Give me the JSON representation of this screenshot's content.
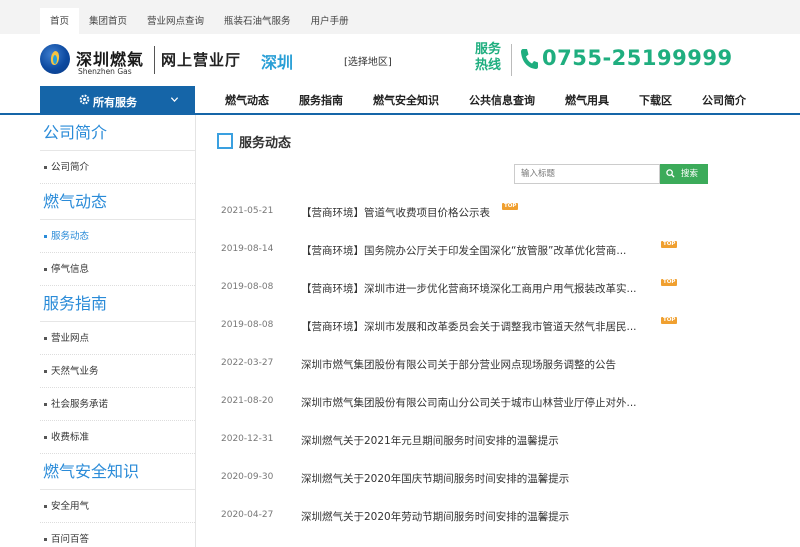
{
  "topnav": {
    "items": [
      {
        "label": "首页",
        "active": true
      },
      {
        "label": "集团首页",
        "active": false
      },
      {
        "label": "营业网点查询",
        "active": false
      },
      {
        "label": "瓶装石油气服务",
        "active": false
      },
      {
        "label": "用户手册",
        "active": false
      }
    ]
  },
  "header": {
    "logo_cn": "深圳燃氣",
    "logo_en": "Shenzhen Gas",
    "hall": "网上营业厅",
    "city": "深圳",
    "select_region": "[选择地区]",
    "hotline_label": "服务热线",
    "hotline_number": "0755-25199999",
    "brand_color": "#1565a8",
    "hotline_color": "#1fae7f",
    "accent_color": "#2a9fd6"
  },
  "mainnav": {
    "all_services": "所有服务",
    "links": [
      "燃气动态",
      "服务指南",
      "燃气安全知识",
      "公共信息查询",
      "燃气用具",
      "下载区",
      "公司简介"
    ]
  },
  "sidebar": {
    "groups": [
      {
        "title": "公司简介",
        "items": [
          {
            "label": "公司简介",
            "active": false
          }
        ]
      },
      {
        "title": "燃气动态",
        "items": [
          {
            "label": "服务动态",
            "active": true
          },
          {
            "label": "停气信息",
            "active": false
          }
        ]
      },
      {
        "title": "服务指南",
        "items": [
          {
            "label": "营业网点",
            "active": false
          },
          {
            "label": "天然气业务",
            "active": false
          },
          {
            "label": "社会服务承诺",
            "active": false
          },
          {
            "label": "收费标准",
            "active": false
          }
        ]
      },
      {
        "title": "燃气安全知识",
        "items": [
          {
            "label": "安全用气",
            "active": false
          },
          {
            "label": "百问百答",
            "active": false
          }
        ]
      }
    ]
  },
  "content": {
    "title": "服务动态",
    "search": {
      "placeholder": "输入标题",
      "button": "搜索",
      "button_color": "#3cab5a"
    },
    "news": [
      {
        "date": "2021-05-21",
        "title": "【营商环境】管道气收费项目价格公示表",
        "top": true
      },
      {
        "date": "2019-08-14",
        "title": "【营商环境】国务院办公厅关于印发全国深化“放管服”改革优化营商...",
        "top": true
      },
      {
        "date": "2019-08-08",
        "title": "【营商环境】深圳市进一步优化营商环境深化工商用户用气报装改革实...",
        "top": true
      },
      {
        "date": "2019-08-08",
        "title": "【营商环境】深圳市发展和改革委员会关于调整我市管道天然气非居民...",
        "top": true
      },
      {
        "date": "2022-03-27",
        "title": "深圳市燃气集团股份有限公司关于部分营业网点现场服务调整的公告",
        "top": false
      },
      {
        "date": "2021-08-20",
        "title": "深圳市燃气集团股份有限公司南山分公司关于城市山林营业厅停止对外...",
        "top": false
      },
      {
        "date": "2020-12-31",
        "title": "深圳燃气关于2021年元旦期间服务时间安排的温馨提示",
        "top": false
      },
      {
        "date": "2020-09-30",
        "title": "深圳燃气关于2020年国庆节期间服务时间安排的温馨提示",
        "top": false
      },
      {
        "date": "2020-04-27",
        "title": "深圳燃气关于2020年劳动节期间服务时间安排的温馨提示",
        "top": false
      }
    ],
    "top_badge": "TOP",
    "badge_color": "#f0a030"
  }
}
